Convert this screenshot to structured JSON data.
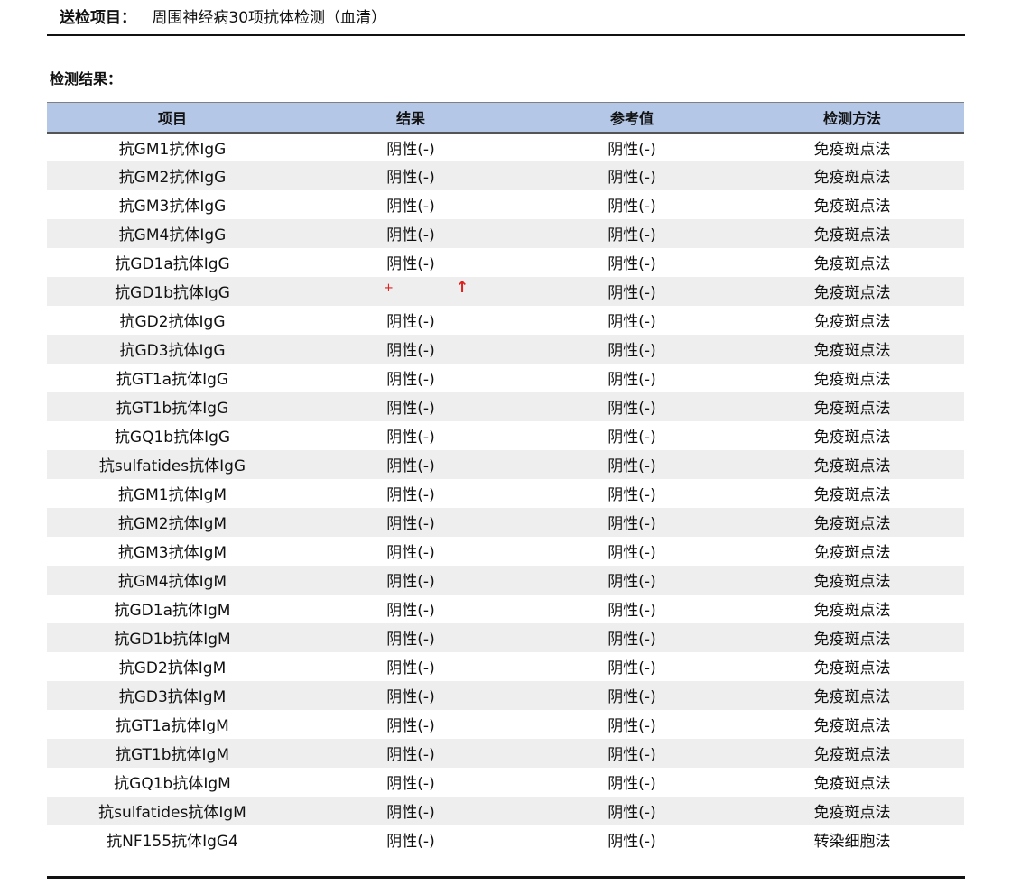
{
  "header": {
    "label": "送检项目：",
    "value": "周围神经病30项抗体检测（血清）"
  },
  "section_title": "检测结果：",
  "table": {
    "columns": [
      "项目",
      "结果",
      "参考值",
      "检测方法"
    ],
    "rows": [
      {
        "item": "抗GM1抗体IgG",
        "result": "阴性(-)",
        "reference": "阴性(-)",
        "method": "免疫斑点法"
      },
      {
        "item": "抗GM2抗体IgG",
        "result": "阴性(-)",
        "reference": "阴性(-)",
        "method": "免疫斑点法"
      },
      {
        "item": "抗GM3抗体IgG",
        "result": "阴性(-)",
        "reference": "阴性(-)",
        "method": "免疫斑点法"
      },
      {
        "item": "抗GM4抗体IgG",
        "result": "阴性(-)",
        "reference": "阴性(-)",
        "method": "免疫斑点法"
      },
      {
        "item": "抗GD1a抗体IgG",
        "result": "阴性(-)",
        "reference": "阴性(-)",
        "method": "免疫斑点法"
      },
      {
        "item": "抗GD1b抗体IgG",
        "result": "+",
        "flag": "↑",
        "reference": "阴性(-)",
        "method": "免疫斑点法"
      },
      {
        "item": "抗GD2抗体IgG",
        "result": "阴性(-)",
        "reference": "阴性(-)",
        "method": "免疫斑点法"
      },
      {
        "item": "抗GD3抗体IgG",
        "result": "阴性(-)",
        "reference": "阴性(-)",
        "method": "免疫斑点法"
      },
      {
        "item": "抗GT1a抗体IgG",
        "result": "阴性(-)",
        "reference": "阴性(-)",
        "method": "免疫斑点法"
      },
      {
        "item": "抗GT1b抗体IgG",
        "result": "阴性(-)",
        "reference": "阴性(-)",
        "method": "免疫斑点法"
      },
      {
        "item": "抗GQ1b抗体IgG",
        "result": "阴性(-)",
        "reference": "阴性(-)",
        "method": "免疫斑点法"
      },
      {
        "item": "抗sulfatides抗体IgG",
        "result": "阴性(-)",
        "reference": "阴性(-)",
        "method": "免疫斑点法"
      },
      {
        "item": "抗GM1抗体IgM",
        "result": "阴性(-)",
        "reference": "阴性(-)",
        "method": "免疫斑点法"
      },
      {
        "item": "抗GM2抗体IgM",
        "result": "阴性(-)",
        "reference": "阴性(-)",
        "method": "免疫斑点法"
      },
      {
        "item": "抗GM3抗体IgM",
        "result": "阴性(-)",
        "reference": "阴性(-)",
        "method": "免疫斑点法"
      },
      {
        "item": "抗GM4抗体IgM",
        "result": "阴性(-)",
        "reference": "阴性(-)",
        "method": "免疫斑点法"
      },
      {
        "item": "抗GD1a抗体IgM",
        "result": "阴性(-)",
        "reference": "阴性(-)",
        "method": "免疫斑点法"
      },
      {
        "item": "抗GD1b抗体IgM",
        "result": "阴性(-)",
        "reference": "阴性(-)",
        "method": "免疫斑点法"
      },
      {
        "item": "抗GD2抗体IgM",
        "result": "阴性(-)",
        "reference": "阴性(-)",
        "method": "免疫斑点法"
      },
      {
        "item": "抗GD3抗体IgM",
        "result": "阴性(-)",
        "reference": "阴性(-)",
        "method": "免疫斑点法"
      },
      {
        "item": "抗GT1a抗体IgM",
        "result": "阴性(-)",
        "reference": "阴性(-)",
        "method": "免疫斑点法"
      },
      {
        "item": "抗GT1b抗体IgM",
        "result": "阴性(-)",
        "reference": "阴性(-)",
        "method": "免疫斑点法"
      },
      {
        "item": "抗GQ1b抗体IgM",
        "result": "阴性(-)",
        "reference": "阴性(-)",
        "method": "免疫斑点法"
      },
      {
        "item": "抗sulfatides抗体IgM",
        "result": "阴性(-)",
        "reference": "阴性(-)",
        "method": "免疫斑点法"
      },
      {
        "item": "抗NF155抗体IgG4",
        "result": "阴性(-)",
        "reference": "阴性(-)",
        "method": "转染细胞法"
      }
    ]
  },
  "colors": {
    "header_bg": "#b4c7e7",
    "stripe_bg": "#eeeeee",
    "positive_flag": "#e02020"
  }
}
